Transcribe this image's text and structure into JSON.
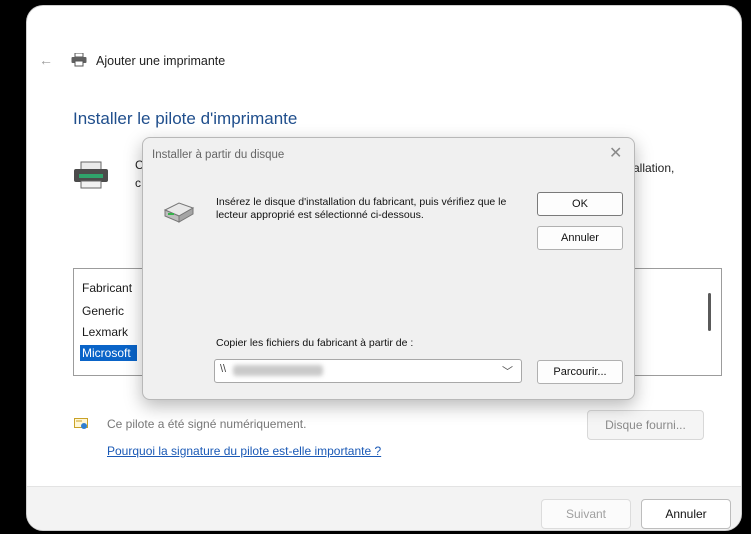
{
  "wizard": {
    "back_glyph": "←",
    "window_title": "Ajouter une imprimante",
    "heading": "Installer le pilote d'imprimante",
    "desc_left_line1": "C",
    "desc_left_line2": "c",
    "desc_right": "allation,",
    "manufacturers_header": "Fabricant",
    "manufacturers": [
      "Generic",
      "Lexmark",
      "Microsoft"
    ],
    "selected_manufacturer": "Microsoft",
    "signed_text": "Ce pilote a été signé numériquement.",
    "signature_link": "Pourquoi la signature du pilote est-elle importante ?",
    "have_disk_button": "Disque fourni...",
    "next_button": "Suivant",
    "cancel_button": "Annuler"
  },
  "dialog": {
    "title": "Installer à partir du disque",
    "close_glyph": "✕",
    "instruction": "Insérez le disque d'installation du fabricant, puis vérifiez que le lecteur approprié est sélectionné ci-dessous.",
    "ok_button": "OK",
    "cancel_button": "Annuler",
    "copy_label": "Copier les fichiers du fabricant à partir de :",
    "path_value": "\\\\",
    "browse_button": "Parcourir..."
  },
  "icons": [
    "back-arrow-icon",
    "printer-icon",
    "printer-large-icon",
    "disk-drive-icon",
    "certificate-icon",
    "chevron-down-icon",
    "close-icon"
  ],
  "colors": {
    "accent_blue": "#1f4e8c",
    "selection": "#0a64c8",
    "link": "#1a59b6"
  }
}
